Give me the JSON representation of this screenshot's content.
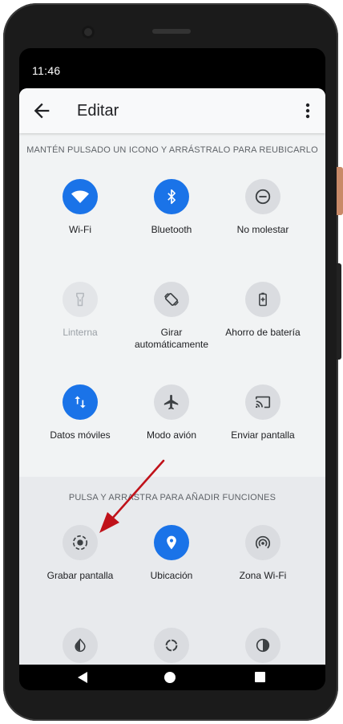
{
  "status_bar": {
    "time": "11:46"
  },
  "toolbar": {
    "title": "Editar",
    "back_icon": "arrow-back-icon",
    "more_icon": "more-vert-icon"
  },
  "active_section": {
    "hint": "MANTÉN PULSADO UN ICONO Y ARRÁSTRALO PARA REUBICARLO",
    "tiles": [
      {
        "label": "Wi-Fi",
        "icon": "wifi-icon",
        "state": "on"
      },
      {
        "label": "Bluetooth",
        "icon": "bluetooth-icon",
        "state": "on"
      },
      {
        "label": "No molestar",
        "icon": "do-not-disturb-icon",
        "state": "off"
      },
      {
        "label": "Linterna",
        "icon": "flashlight-icon",
        "state": "unavailable"
      },
      {
        "label": "Girar\nautomáticamente",
        "icon": "auto-rotate-icon",
        "state": "off"
      },
      {
        "label": "Ahorro de batería",
        "icon": "battery-saver-icon",
        "state": "off"
      },
      {
        "label": "Datos móviles",
        "icon": "mobile-data-icon",
        "state": "on"
      },
      {
        "label": "Modo avión",
        "icon": "airplane-icon",
        "state": "off"
      },
      {
        "label": "Enviar pantalla",
        "icon": "cast-icon",
        "state": "off"
      }
    ]
  },
  "available_section": {
    "hint": "PULSA Y ARRASTRA PARA AÑADIR FUNCIONES",
    "tiles": [
      {
        "label": "Grabar pantalla",
        "icon": "screen-record-icon",
        "state": "off"
      },
      {
        "label": "Ubicación",
        "icon": "location-icon",
        "state": "on"
      },
      {
        "label": "Zona Wi-Fi",
        "icon": "hotspot-icon",
        "state": "off"
      },
      {
        "label": "",
        "icon": "invert-colors-icon",
        "state": "off"
      },
      {
        "label": "",
        "icon": "sync-icon",
        "state": "off"
      },
      {
        "label": "",
        "icon": "contrast-icon",
        "state": "off"
      }
    ]
  },
  "annotation": {
    "arrow_color": "#c0121a"
  },
  "nav_bar": {
    "back_icon": "nav-back-icon",
    "home_icon": "nav-home-icon",
    "recents_icon": "nav-recents-icon"
  },
  "colors": {
    "accent": "#1a73e8",
    "tile_off": "#dadce0",
    "background": "#f1f3f4"
  }
}
